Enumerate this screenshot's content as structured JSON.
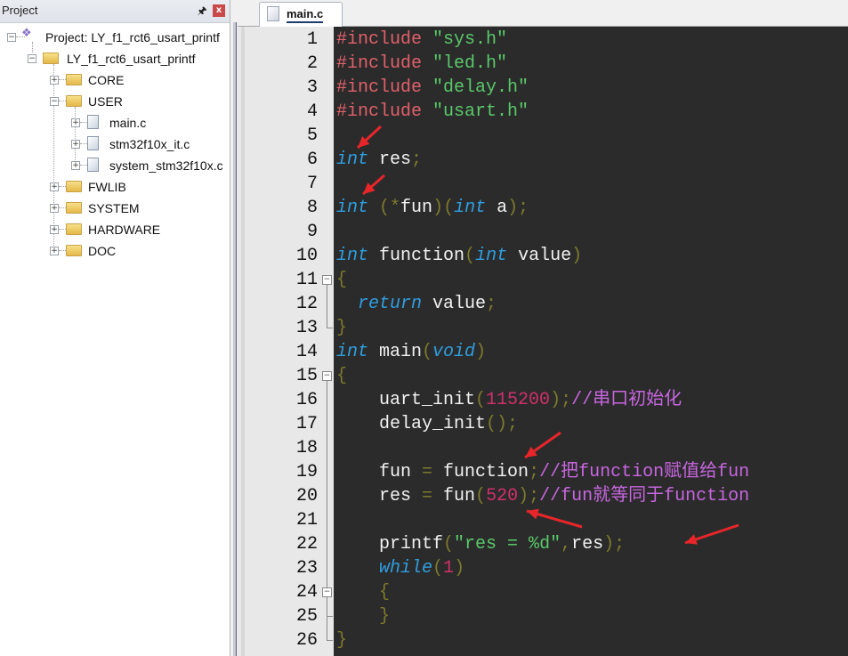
{
  "project_panel": {
    "title": "Project",
    "pin_icon": "pushpin-icon",
    "close_icon": "close-icon",
    "close_glyph": "x",
    "tree": {
      "root_label": "Project: LY_f1_rct6_usart_printf",
      "target_label": "LY_f1_rct6_usart_printf",
      "groups": [
        {
          "label": "CORE",
          "expanded": false
        },
        {
          "label": "USER",
          "expanded": true,
          "files": [
            "main.c",
            "stm32f10x_it.c",
            "system_stm32f10x.c"
          ]
        },
        {
          "label": "FWLIB",
          "expanded": false
        },
        {
          "label": "SYSTEM",
          "expanded": false
        },
        {
          "label": "HARDWARE",
          "expanded": false
        },
        {
          "label": "DOC",
          "expanded": false
        }
      ]
    }
  },
  "editor": {
    "active_tab": "main.c",
    "colors": {
      "background": "#2b2b2b",
      "keyword": "#2f9ee0",
      "string": "#59c96a",
      "preprocessor": "#e0606a",
      "number": "#d0306a",
      "comment": "#c866e0",
      "punctuation": "#7e7a2c"
    },
    "lines": [
      {
        "n": "1",
        "tokens": [
          [
            "pp",
            "#include "
          ],
          [
            "str",
            "\"sys.h\""
          ]
        ]
      },
      {
        "n": "2",
        "tokens": [
          [
            "pp",
            "#include "
          ],
          [
            "str",
            "\"led.h\""
          ]
        ]
      },
      {
        "n": "3",
        "tokens": [
          [
            "pp",
            "#include "
          ],
          [
            "str",
            "\"delay.h\""
          ]
        ]
      },
      {
        "n": "4",
        "tokens": [
          [
            "pp",
            "#include "
          ],
          [
            "str",
            "\"usart.h\""
          ]
        ]
      },
      {
        "n": "5",
        "tokens": []
      },
      {
        "n": "6",
        "tokens": [
          [
            "kw",
            "int"
          ],
          [
            "id",
            " res"
          ],
          [
            "pn",
            ";"
          ]
        ]
      },
      {
        "n": "7",
        "tokens": []
      },
      {
        "n": "8",
        "tokens": [
          [
            "kw",
            "int"
          ],
          [
            "id",
            " "
          ],
          [
            "pn",
            "(*"
          ],
          [
            "id",
            "fun"
          ],
          [
            "pn",
            ")("
          ],
          [
            "kw",
            "int"
          ],
          [
            "id",
            " a"
          ],
          [
            "pn",
            ");"
          ]
        ]
      },
      {
        "n": "9",
        "tokens": []
      },
      {
        "n": "10",
        "tokens": [
          [
            "kw",
            "int"
          ],
          [
            "id",
            " function"
          ],
          [
            "pn",
            "("
          ],
          [
            "kw",
            "int"
          ],
          [
            "id",
            " value"
          ],
          [
            "pn",
            ")"
          ]
        ]
      },
      {
        "n": "11",
        "tokens": [
          [
            "pn",
            "{"
          ]
        ]
      },
      {
        "n": "12",
        "tokens": [
          [
            "id",
            "  "
          ],
          [
            "kw",
            "return"
          ],
          [
            "id",
            " value"
          ],
          [
            "pn",
            ";"
          ]
        ]
      },
      {
        "n": "13",
        "tokens": [
          [
            "pn",
            "}"
          ]
        ]
      },
      {
        "n": "14",
        "tokens": [
          [
            "kw",
            "int"
          ],
          [
            "id",
            " main"
          ],
          [
            "pn",
            "("
          ],
          [
            "kw",
            "void"
          ],
          [
            "pn",
            ")"
          ]
        ]
      },
      {
        "n": "15",
        "tokens": [
          [
            "pn",
            "{"
          ]
        ]
      },
      {
        "n": "16",
        "tokens": [
          [
            "id",
            "    uart_init"
          ],
          [
            "pn",
            "("
          ],
          [
            "num",
            "115200"
          ],
          [
            "pn",
            ");"
          ],
          [
            "cm",
            "//串口初始化"
          ]
        ]
      },
      {
        "n": "17",
        "tokens": [
          [
            "id",
            "    delay_init"
          ],
          [
            "pn",
            "();"
          ]
        ]
      },
      {
        "n": "18",
        "tokens": []
      },
      {
        "n": "19",
        "tokens": [
          [
            "id",
            "    fun "
          ],
          [
            "pn",
            "="
          ],
          [
            "id",
            " function"
          ],
          [
            "pn",
            ";"
          ],
          [
            "cm",
            "//把function赋值给fun"
          ]
        ]
      },
      {
        "n": "20",
        "tokens": [
          [
            "id",
            "    res "
          ],
          [
            "pn",
            "="
          ],
          [
            "id",
            " fun"
          ],
          [
            "pn",
            "("
          ],
          [
            "num",
            "520"
          ],
          [
            "pn",
            ");"
          ],
          [
            "cm",
            "//fun就等同于function"
          ]
        ]
      },
      {
        "n": "21",
        "tokens": []
      },
      {
        "n": "22",
        "tokens": [
          [
            "id",
            "    printf"
          ],
          [
            "pn",
            "("
          ],
          [
            "str",
            "\"res = %d\""
          ],
          [
            "pn",
            ","
          ],
          [
            "id",
            "res"
          ],
          [
            "pn",
            ");"
          ]
        ]
      },
      {
        "n": "23",
        "tokens": [
          [
            "id",
            "    "
          ],
          [
            "kw",
            "while"
          ],
          [
            "pn",
            "("
          ],
          [
            "num",
            "1"
          ],
          [
            "pn",
            ")"
          ]
        ]
      },
      {
        "n": "24",
        "tokens": [
          [
            "id",
            "    "
          ],
          [
            "pn",
            "{"
          ]
        ]
      },
      {
        "n": "25",
        "tokens": [
          [
            "id",
            "    "
          ],
          [
            "pn",
            "}"
          ]
        ]
      },
      {
        "n": "26",
        "tokens": [
          [
            "pn",
            "}"
          ]
        ]
      }
    ],
    "fold_markers": [
      "11",
      "15",
      "24"
    ]
  },
  "annotations": {
    "arrow_color": "#e8262a",
    "count": 6
  }
}
